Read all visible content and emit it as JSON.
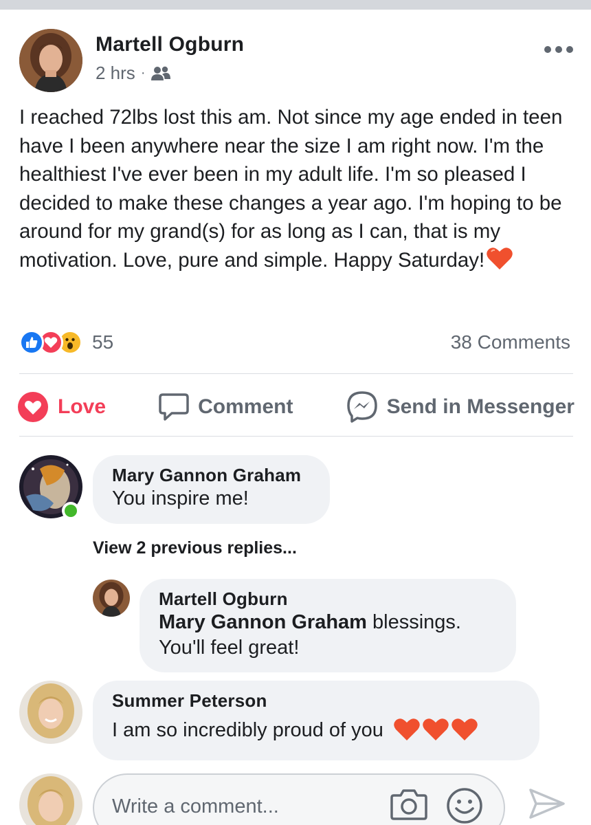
{
  "post": {
    "author": "Martell Ogburn",
    "time": "2 hrs",
    "separator": "·",
    "audience_icon": "friends-icon",
    "body": "I reached 72lbs lost this am. Not since my age ended in teen have I been anywhere near the size I am right now. I'm the healthiest I've ever been in my adult life. I'm so pleased I decided to make these changes a year ago. I'm hoping to be around for my grand(s) for as long as I can, that is my motivation.  Love, pure and simple. Happy Saturday!",
    "body_emoji": "heart-emoji",
    "more_icon": "more-options-icon"
  },
  "reactions": {
    "types": [
      "like",
      "love",
      "wow"
    ],
    "count": "55",
    "comments_label": "38 Comments"
  },
  "actions": {
    "love_label": "Love",
    "comment_label": "Comment",
    "messenger_label": "Send in Messenger"
  },
  "comments": [
    {
      "author": "Mary Gannon Graham",
      "text": "You inspire me!",
      "online": true
    },
    {
      "author": "Summer Peterson",
      "text": "I am so incredibly proud of you",
      "emoji": "heart-emoji ×3"
    }
  ],
  "view_replies_label": "View 2 previous replies...",
  "reply": {
    "author": "Martell Ogburn",
    "mention": "Mary Gannon Graham",
    "text_part1": " blessings.",
    "text_part2": "You'll feel great!"
  },
  "composer": {
    "placeholder": "Write a comment...",
    "camera_icon": "camera-icon",
    "emoji_icon": "emoji-icon",
    "send_icon": "send-icon"
  },
  "colors": {
    "love": "#f33e58",
    "like": "#1877f2",
    "online": "#42b72a",
    "bubble": "#f0f2f5",
    "muted_text": "#606770"
  }
}
